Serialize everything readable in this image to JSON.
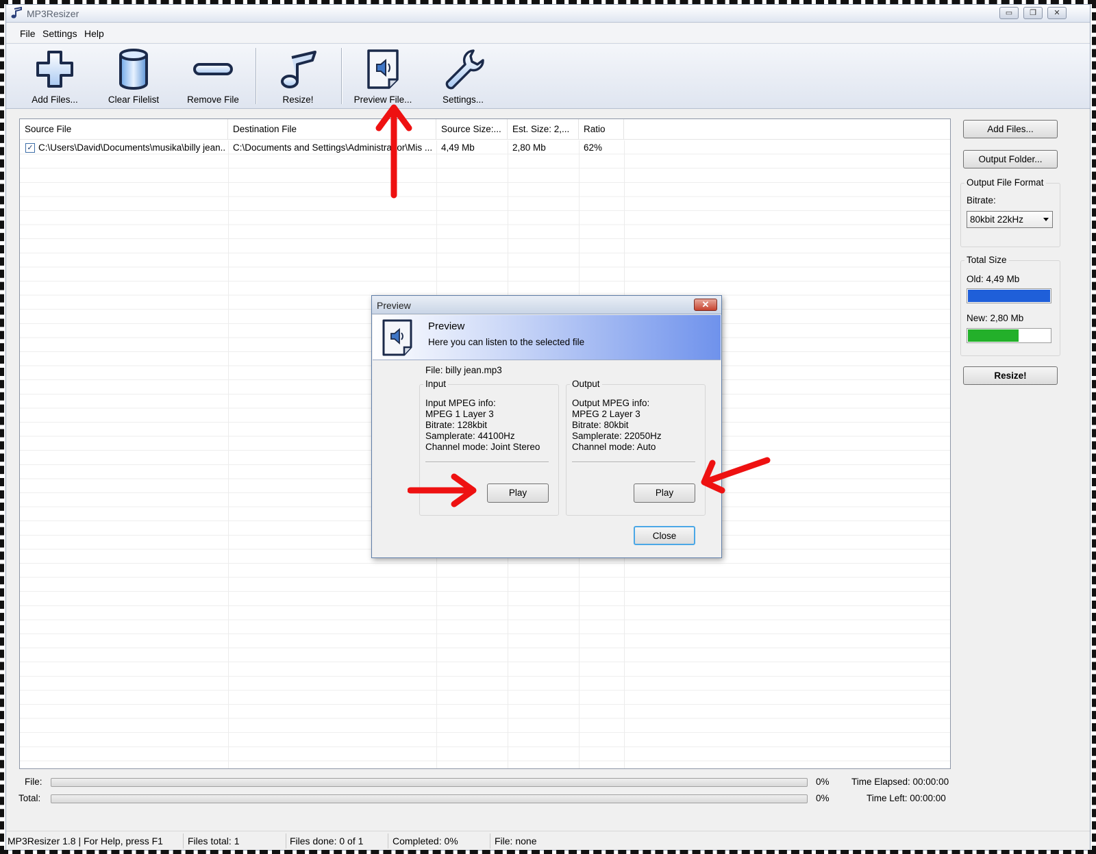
{
  "window": {
    "title": "MP3Resizer",
    "controls": {
      "minimize": "▭",
      "restore": "❐",
      "close": "✕"
    }
  },
  "menu": {
    "items": [
      "File",
      "Settings",
      "Help"
    ]
  },
  "toolbar": {
    "add_files": "Add Files...",
    "clear_filelist": "Clear Filelist",
    "remove_file": "Remove File",
    "resize": "Resize!",
    "preview_file": "Preview File...",
    "settings": "Settings..."
  },
  "file_list": {
    "columns": [
      "Source File",
      "Destination File",
      "Source Size:...",
      "Est. Size: 2,...",
      "Ratio"
    ],
    "rows": [
      {
        "checked": "✓",
        "source": "C:\\Users\\David\\Documents\\musika\\billy jean...",
        "destination": "C:\\Documents and Settings\\Administrador\\Mis ...",
        "source_size": "4,49 Mb",
        "est_size": "2,80 Mb",
        "ratio": "62%"
      }
    ]
  },
  "side_panel": {
    "add_files": "Add Files...",
    "output_folder": "Output Folder...",
    "output_format_legend": "Output File Format",
    "bitrate_label": "Bitrate:",
    "bitrate_value": "80kbit 22kHz",
    "total_size_legend": "Total Size",
    "old_label": "Old: 4,49 Mb",
    "new_label": "New: 2,80 Mb",
    "old_fraction": 1.0,
    "new_fraction": 0.62,
    "resize": "Resize!"
  },
  "progress": {
    "file_label": "File:",
    "file_percent": "0%",
    "total_label": "Total:",
    "total_percent": "0%",
    "time_elapsed": "Time Elapsed: 00:00:00",
    "time_left": "Time Left: 00:00:00"
  },
  "status_bar": {
    "app": "MP3Resizer 1.8 | For Help, press F1",
    "files_total": "Files total: 1",
    "files_done": "Files done: 0 of 1",
    "completed": "Completed:  0%",
    "file": "File: none"
  },
  "dialog": {
    "title": "Preview",
    "heading": "Preview",
    "subheading": "Here you can listen to the selected file",
    "file": "File: billy jean.mp3",
    "input": {
      "legend": "Input",
      "lines": [
        "Input MPEG info:",
        "MPEG 1 Layer 3",
        "Bitrate: 128kbit",
        "Samplerate: 44100Hz",
        "Channel mode: Joint Stereo"
      ],
      "play": "Play"
    },
    "output": {
      "legend": "Output",
      "lines": [
        "Output MPEG info:",
        "MPEG 2 Layer 3",
        "Bitrate: 80kbit",
        "Samplerate: 22050Hz",
        "Channel mode: Auto"
      ],
      "play": "Play"
    },
    "close": "Close"
  },
  "colors": {
    "old_bar": "#1f5fd9",
    "new_bar": "#23b02a",
    "annotation_arrow": "#ee1111",
    "banner_end": "#6f92ec"
  },
  "icons": {
    "add_files": "plus-icon",
    "clear_filelist": "cylinder-icon",
    "remove_file": "minus-icon",
    "resize": "music-note-icon",
    "preview_file": "speaker-document-icon",
    "settings": "wrench-icon"
  }
}
